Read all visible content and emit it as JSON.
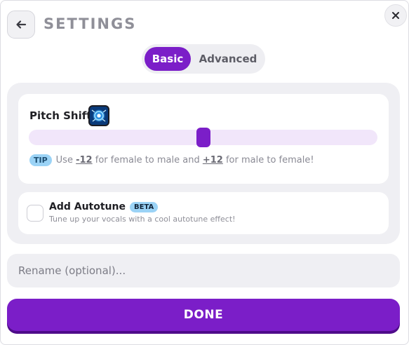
{
  "header": {
    "title": "SETTINGS",
    "back_icon": "arrow-left-icon",
    "close_icon": "close-icon"
  },
  "tabs": [
    {
      "label": "Basic",
      "active": true
    },
    {
      "label": "Advanced",
      "active": false
    }
  ],
  "pitch_shift": {
    "label": "Pitch Shift",
    "image_icon": "voice-avatar-icon",
    "slider": {
      "min": -12,
      "max": 12,
      "value": 0
    },
    "tip": {
      "badge": "TIP",
      "text_1": "Use",
      "value_1": "-12",
      "text_2": "for female to male and",
      "value_2": "+12",
      "text_3": "for male to female!"
    }
  },
  "autotune": {
    "label": "Add Autotune",
    "badge": "BETA",
    "description": "Tune up your vocals with a cool autotune effect!",
    "checked": false
  },
  "rename": {
    "placeholder": "Rename (optional)...",
    "value": ""
  },
  "done_button": {
    "label": "DONE"
  },
  "colors": {
    "accent": "#7b1ec8",
    "accent_light": "#f1e6fa",
    "badge": "#9bd3f6",
    "panel": "#efeff3",
    "muted_text": "#8f8f98"
  }
}
